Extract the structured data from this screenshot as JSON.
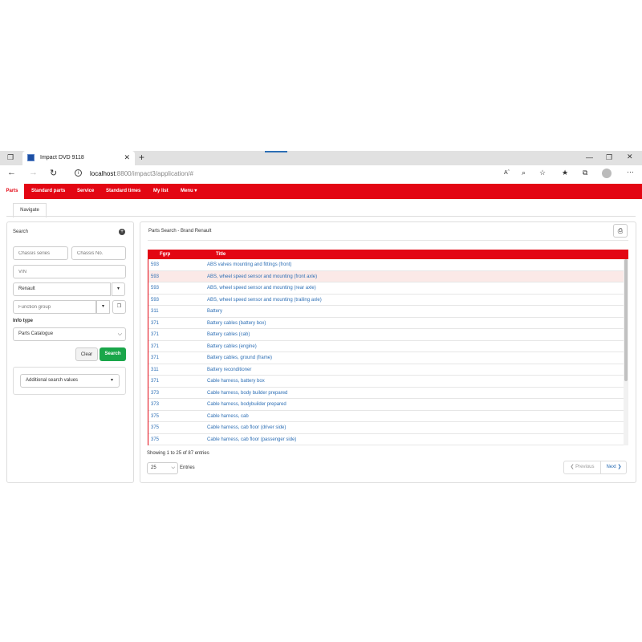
{
  "browser": {
    "tab_title": "Impact DVD 9118",
    "new_tab": "+",
    "url_host": "localhost",
    "url_rest": ":8800/impact3/application/#"
  },
  "nav": {
    "items": [
      "Parts",
      "Standard parts",
      "Service",
      "Standard times",
      "My list",
      "Menu ▾"
    ]
  },
  "subnav": {
    "tab": "Navigate"
  },
  "search": {
    "title": "Search",
    "chassis_series_placeholder": "Chassis series",
    "chassis_no_placeholder": "Chassis No.",
    "vin_placeholder": "VIN",
    "brand_value": "Renault",
    "function_group_placeholder": "Function group",
    "info_type_label": "Info type",
    "info_type_value": "Parts Catalogue",
    "clear_label": "Clear",
    "search_label": "Search",
    "additional_label": "Additional search values"
  },
  "results": {
    "title": "Parts Search - Brand Renault",
    "columns": [
      "Fgrp",
      "Title"
    ],
    "rows": [
      {
        "fgrp": "593",
        "title": "ABS valves mounting and fittings (front)"
      },
      {
        "fgrp": "593",
        "title": "ABS, wheel speed sensor and mounting (front axle)"
      },
      {
        "fgrp": "593",
        "title": "ABS, wheel speed sensor and mounting (rear axle)"
      },
      {
        "fgrp": "593",
        "title": "ABS, wheel speed sensor and mounting (trailing axle)"
      },
      {
        "fgrp": "311",
        "title": "Battery"
      },
      {
        "fgrp": "371",
        "title": "Battery cables (battery box)"
      },
      {
        "fgrp": "371",
        "title": "Battery cables (cab)"
      },
      {
        "fgrp": "371",
        "title": "Battery cables (engine)"
      },
      {
        "fgrp": "371",
        "title": "Battery cables, ground (frame)"
      },
      {
        "fgrp": "311",
        "title": "Battery reconditioner"
      },
      {
        "fgrp": "371",
        "title": "Cable harness, battery box"
      },
      {
        "fgrp": "373",
        "title": "Cable harness, body builder prepared"
      },
      {
        "fgrp": "373",
        "title": "Cable harness, bodybuilder prepared"
      },
      {
        "fgrp": "375",
        "title": "Cable harness, cab"
      },
      {
        "fgrp": "375",
        "title": "Cable harness, cab floor (driver side)"
      },
      {
        "fgrp": "375",
        "title": "Cable harness, cab floor (passenger side)"
      }
    ],
    "selected_row": 1,
    "showing_text": "Showing 1 to 25 of 87 entries",
    "page_size": "25",
    "entries_label": "Entries",
    "prev_label": "Previous",
    "next_label": "Next"
  },
  "colors": {
    "accent": "#e30613",
    "link": "#2d6fb5",
    "search_button": "#1aa64a"
  }
}
